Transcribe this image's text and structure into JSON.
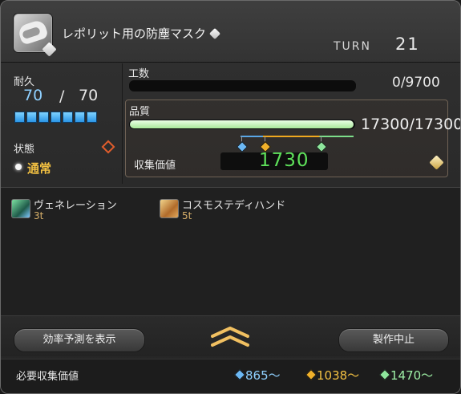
{
  "item": {
    "name": "レポリット用の防塵マスク",
    "icon": "dust-mask-icon",
    "hq_icon": "hq-badge-icon"
  },
  "turn": {
    "label": "TURN",
    "value": "21"
  },
  "durability": {
    "label": "耐久",
    "current": "70",
    "separator": "/",
    "max": "70",
    "fraction": 1.0
  },
  "condition": {
    "label": "状態",
    "value": "通常"
  },
  "progress": {
    "label": "工数",
    "value": "0/9700",
    "fraction": 0.0
  },
  "quality": {
    "label": "品質",
    "value": "17300/17300",
    "fraction": 1.0
  },
  "collectability": {
    "label": "収集価値",
    "value": "1730"
  },
  "buffs": [
    {
      "name": "ヴェネレーション",
      "turns": "3t",
      "icon": "veneration-icon"
    },
    {
      "name": "コスモステディハンド",
      "turns": "5t",
      "icon": "cosmos-steady-hand-icon"
    }
  ],
  "buttons": {
    "predict": "効率予測を表示",
    "abort": "製作中止"
  },
  "requirements": {
    "label": "必要収集価値",
    "tiers": [
      {
        "value": "865～",
        "color": "#6cb8f4"
      },
      {
        "value": "1038～",
        "color": "#f1b12a"
      },
      {
        "value": "1470～",
        "color": "#8ee69c"
      }
    ]
  },
  "colors": {
    "collect_value": "#5ee05a",
    "condition": "#f3c142",
    "durability_current": "#8fd0ff"
  }
}
